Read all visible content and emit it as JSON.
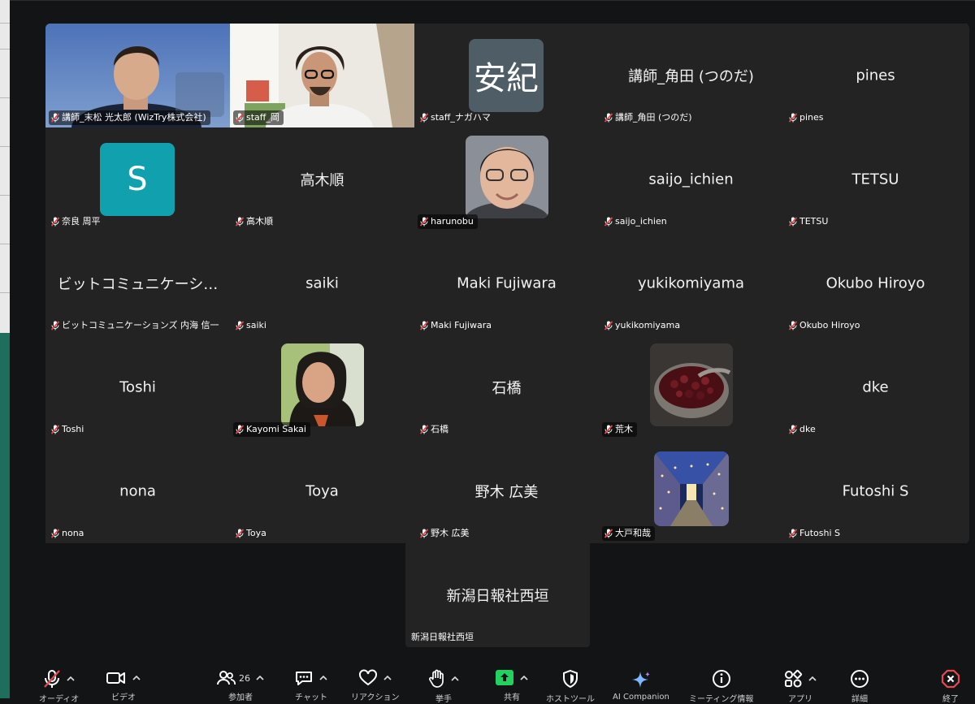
{
  "participants_count": "26",
  "grid": [
    {
      "label": "講師_末松 光太郎 (WizTry株式会社)",
      "kind": "video-man-glasses-off",
      "active": true
    },
    {
      "label": "staff_岡",
      "kind": "video-man-glasses"
    },
    {
      "label": "staff_ナガハマ",
      "kind": "avatar",
      "avatar_text": "安紀",
      "avatar_color": "#4f5d66"
    },
    {
      "label": "講師_角田 (つのだ)",
      "kind": "name",
      "name": "講師_角田 (つのだ)"
    },
    {
      "label": "pines",
      "kind": "name",
      "name": "pines"
    },
    {
      "label": "奈良 周平",
      "kind": "avatar",
      "avatar_text": "S",
      "avatar_color": "#11a1ae"
    },
    {
      "label": "高木順",
      "kind": "name",
      "name": "高木順"
    },
    {
      "label": "harunobu",
      "kind": "photo-man"
    },
    {
      "label": "saijo_ichien",
      "kind": "name",
      "name": "saijo_ichien"
    },
    {
      "label": "TETSU",
      "kind": "name",
      "name": "TETSU"
    },
    {
      "label": "ビットコミュニケーションズ 内海 信一",
      "kind": "name",
      "name": "ビットコミュニケーシ…"
    },
    {
      "label": "saiki",
      "kind": "name",
      "name": "saiki"
    },
    {
      "label": "Maki Fujiwara",
      "kind": "name",
      "name": "Maki Fujiwara"
    },
    {
      "label": "yukikomiyama",
      "kind": "name",
      "name": "yukikomiyama"
    },
    {
      "label": "Okubo Hiroyo",
      "kind": "name",
      "name": "Okubo Hiroyo"
    },
    {
      "label": "Toshi",
      "kind": "name",
      "name": "Toshi"
    },
    {
      "label": "Kayomi Sakai",
      "kind": "photo-woman"
    },
    {
      "label": "石橋",
      "kind": "name",
      "name": "石橋"
    },
    {
      "label": "荒木",
      "kind": "photo-beans"
    },
    {
      "label": "dke",
      "kind": "name",
      "name": "dke"
    },
    {
      "label": "nona",
      "kind": "name",
      "name": "nona"
    },
    {
      "label": "Toya",
      "kind": "name",
      "name": "Toya"
    },
    {
      "label": "野木 広美",
      "kind": "name",
      "name": "野木 広美"
    },
    {
      "label": "大戸和哉",
      "kind": "photo-lights"
    },
    {
      "label": "Futoshi S",
      "kind": "name",
      "name": "Futoshi S"
    }
  ],
  "extra_tile": {
    "label": "新潟日報社西垣",
    "name": "新潟日報社西垣"
  },
  "toolbar": {
    "audio": "オーディオ",
    "video": "ビデオ",
    "participants": "参加者",
    "chat": "チャット",
    "reactions": "リアクション",
    "raise_hand": "挙手",
    "share": "共有",
    "host_tools": "ホストツール",
    "ai_companion": "AI Companion",
    "meeting_info": "ミーティング情報",
    "apps": "アプリ",
    "more": "詳細",
    "end": "終了"
  },
  "colors": {
    "active_speaker": "#23d160",
    "share_green": "#23d160",
    "end_red": "#e5484d",
    "ai_blue": "#7db7ff"
  }
}
